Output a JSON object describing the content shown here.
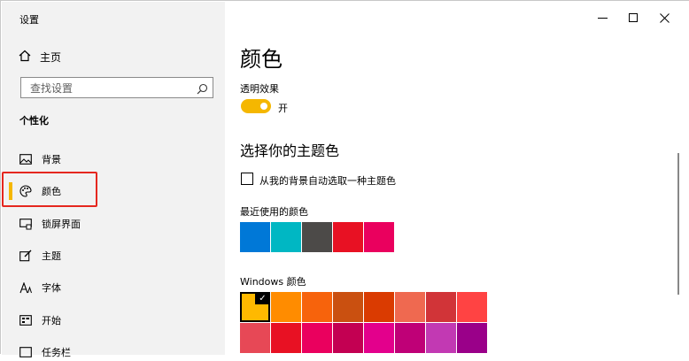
{
  "window": {
    "title": "设置"
  },
  "controls": {
    "minimize": "minimize",
    "maximize": "maximize",
    "close": "close"
  },
  "sidebar": {
    "home_label": "主页",
    "search_placeholder": "查找设置",
    "section": "个性化",
    "items": [
      {
        "label": "背景",
        "icon": "image-icon"
      },
      {
        "label": "颜色",
        "icon": "palette-icon",
        "selected": true
      },
      {
        "label": "锁屏界面",
        "icon": "lock-screen-icon"
      },
      {
        "label": "主题",
        "icon": "theme-icon"
      },
      {
        "label": "字体",
        "icon": "font-icon"
      },
      {
        "label": "开始",
        "icon": "start-icon"
      },
      {
        "label": "任务栏",
        "icon": "taskbar-icon"
      }
    ]
  },
  "main": {
    "title": "颜色",
    "transparency_label": "透明效果",
    "transparency_state": "开",
    "accent_heading": "选择你的主题色",
    "auto_pick_label": "从我的背景自动选取一种主题色",
    "recent_label": "最近使用的颜色",
    "recent_colors": [
      "#0078d7",
      "#00b7c3",
      "#4c4a48",
      "#e81123",
      "#ea005e"
    ],
    "windows_label": "Windows 颜色",
    "windows_row1": [
      "#ffb900",
      "#ff8c00",
      "#f7630c",
      "#ca5010",
      "#da3b01",
      "#ef6950",
      "#d13438",
      "#ff4343"
    ],
    "windows_row2": [
      "#e74856",
      "#e81123",
      "#ea005e",
      "#c30052",
      "#e3008c",
      "#bf0077",
      "#c239b3",
      "#9a0089"
    ]
  },
  "colors": {
    "accent": "#f5b700",
    "annotation": "#e5271f"
  }
}
